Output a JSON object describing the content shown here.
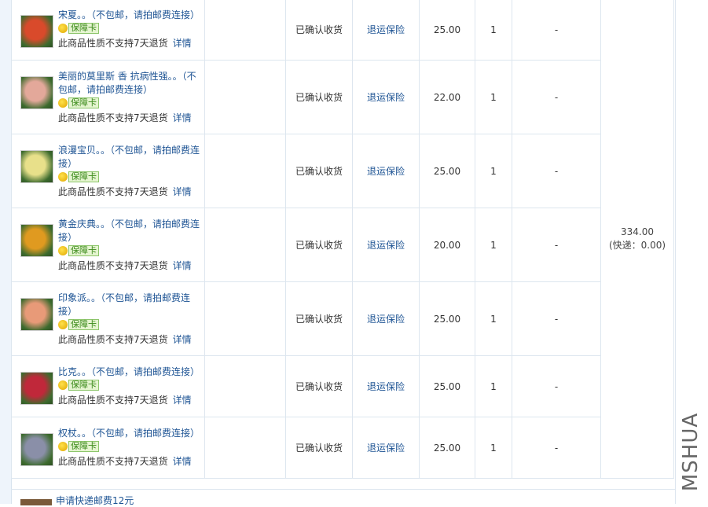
{
  "badge_label": "保障卡",
  "no_return_text": "此商品性质不支持7天退货",
  "detail_link": "详情",
  "status_text": "已确认收货",
  "service_link": "退运保险",
  "discount_placeholder": "-",
  "order_total": {
    "amount": "334.00",
    "shipping": "(快递：0.00)"
  },
  "watermark": "MSHUA",
  "items": [
    {
      "title": "宋夏。。（不包邮，请拍邮费连接）",
      "price": "25.00",
      "qty": "1",
      "thumb_color": "#d94a2b"
    },
    {
      "title": "美丽的莫里斯 香 抗病性强。。（不包邮，请拍邮费连接）",
      "price": "22.00",
      "qty": "1",
      "thumb_color": "#e3a89a"
    },
    {
      "title": "浪漫宝贝。。（不包邮，请拍邮费连接）",
      "price": "25.00",
      "qty": "1",
      "thumb_color": "#e8e08a"
    },
    {
      "title": "黄金庆典。。（不包邮，请拍邮费连接）",
      "price": "20.00",
      "qty": "1",
      "thumb_color": "#e09a20"
    },
    {
      "title": "印象派。。（不包邮，请拍邮费连接）",
      "price": "25.00",
      "qty": "1",
      "thumb_color": "#e89a78"
    },
    {
      "title": "比克。。（不包邮，请拍邮费连接）",
      "price": "25.00",
      "qty": "1",
      "thumb_color": "#c0283a"
    },
    {
      "title": "权杖。。（不包邮，请拍邮费连接）",
      "price": "25.00",
      "qty": "1",
      "thumb_color": "#8a8fa8"
    }
  ],
  "partial_item_title": "申请快递邮费12元"
}
